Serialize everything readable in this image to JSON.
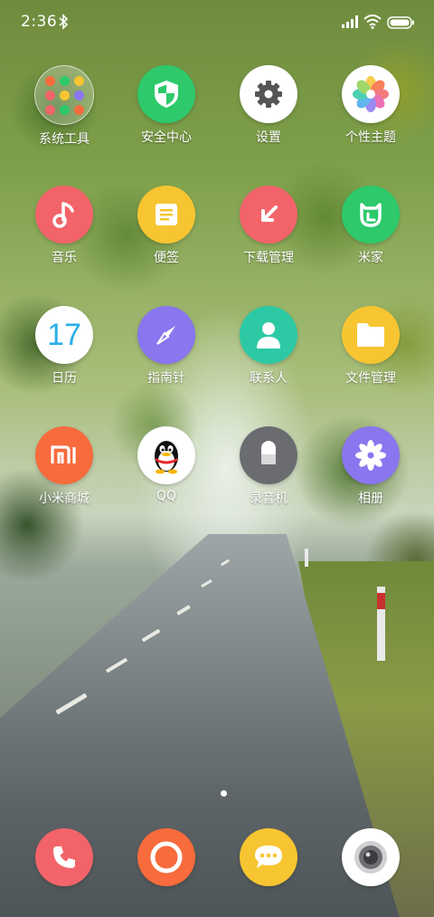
{
  "status_bar": {
    "time": "2:36",
    "icons": [
      "bluetooth-icon",
      "signal-icon",
      "wifi-icon",
      "battery-icon"
    ]
  },
  "apps": [
    {
      "label": "系统工具",
      "icon": "folder-icon",
      "color": "#ffffff"
    },
    {
      "label": "安全中心",
      "icon": "shield-icon",
      "color": "#2dc96b"
    },
    {
      "label": "设置",
      "icon": "gear-icon",
      "color": "#ffffff"
    },
    {
      "label": "个性主题",
      "icon": "flower-icon",
      "color": "#ffffff"
    },
    {
      "label": "音乐",
      "icon": "music-note-icon",
      "color": "#f2646a"
    },
    {
      "label": "便签",
      "icon": "notes-icon",
      "color": "#f7c531"
    },
    {
      "label": "下载管理",
      "icon": "download-arrow-icon",
      "color": "#f2646a"
    },
    {
      "label": "米家",
      "icon": "mijia-icon",
      "color": "#2dc96b"
    },
    {
      "label": "日历",
      "icon": "calendar-icon",
      "color": "#ffffff",
      "day": "17"
    },
    {
      "label": "指南针",
      "icon": "compass-icon",
      "color": "#8a76ee"
    },
    {
      "label": "联系人",
      "icon": "contact-icon",
      "color": "#2dc9a5"
    },
    {
      "label": "文件管理",
      "icon": "folder-file-icon",
      "color": "#f7c531"
    },
    {
      "label": "小米商城",
      "icon": "mi-logo-icon",
      "color": "#f76b3c"
    },
    {
      "label": "QQ",
      "icon": "penguin-icon",
      "color": "#ffffff"
    },
    {
      "label": "录音机",
      "icon": "microphone-icon",
      "color": "#6a6c70"
    },
    {
      "label": "相册",
      "icon": "pinwheel-icon",
      "color": "#8a76ee"
    }
  ],
  "dock": [
    {
      "icon": "phone-icon",
      "color": "#f2646a"
    },
    {
      "icon": "browser-ring-icon",
      "color": "#f76b3c"
    },
    {
      "icon": "messages-icon",
      "color": "#f7c531"
    },
    {
      "icon": "camera-icon",
      "color": "#ffffff"
    }
  ]
}
